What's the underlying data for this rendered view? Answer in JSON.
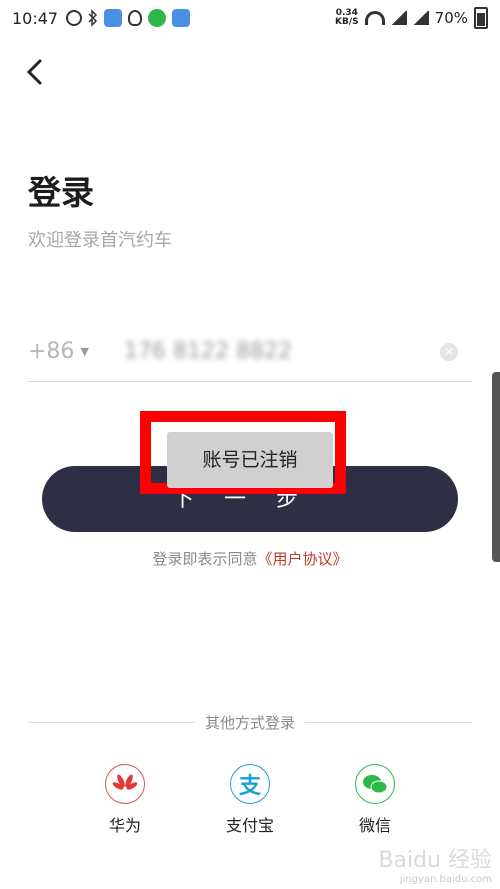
{
  "status_bar": {
    "time": "10:47",
    "network_speed": "0.34",
    "network_unit": "KB/S",
    "battery": "70%"
  },
  "page": {
    "title": "登录",
    "subtitle": "欢迎登录首汽约车"
  },
  "phone": {
    "country_code": "+86",
    "value": "176 8122 8822"
  },
  "toast": {
    "message": "账号已注销"
  },
  "submit": {
    "label": "下一步"
  },
  "agreement": {
    "prefix": "登录即表示同意",
    "link": "《用户协议》"
  },
  "other_login": {
    "label": "其他方式登录",
    "options": [
      {
        "name": "华为",
        "icon": "huawei-icon"
      },
      {
        "name": "支付宝",
        "icon": "alipay-icon"
      },
      {
        "name": "微信",
        "icon": "wechat-icon"
      }
    ]
  },
  "watermark": {
    "text": "Baidu 经验",
    "sub": "jingyan.baidu.com"
  },
  "colors": {
    "button": "#2e2f45",
    "highlight": "#ff0000",
    "link": "#c0392b"
  }
}
